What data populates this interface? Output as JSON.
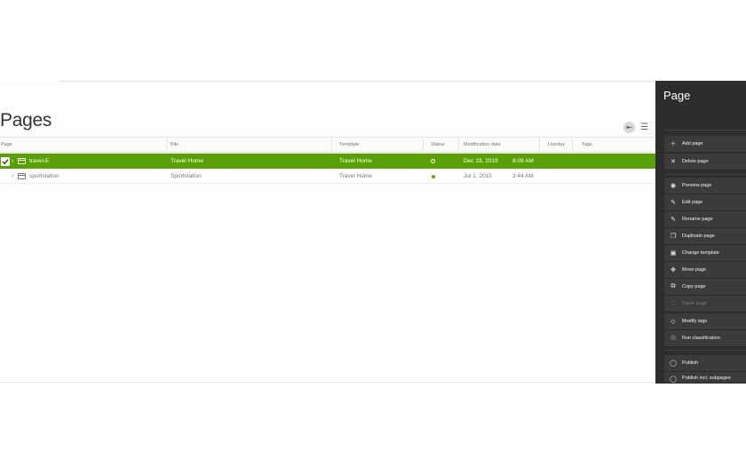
{
  "page": {
    "title": "Pages"
  },
  "table": {
    "columns": [
      "Page",
      "Title",
      "Template",
      "Status",
      "Modification date",
      "Liveday",
      "Tags"
    ],
    "rows": [
      {
        "name": "travel-E",
        "title": "Travel Home",
        "template": "Travel Home",
        "date": "Dec 19, 2019",
        "time": "8:09 AM",
        "selected": true
      },
      {
        "name": "sportstation",
        "title": "Sportstation",
        "template": "Travel Home",
        "date": "Jul 1, 2015",
        "time": "3:44 AM",
        "selected": false
      }
    ]
  },
  "panel": {
    "title": "Page",
    "groups": [
      [
        {
          "label": "Add page",
          "icon": "plus-icon"
        },
        {
          "label": "Delete page",
          "icon": "close-icon"
        }
      ],
      [
        {
          "label": "Preview page",
          "icon": "eye-icon"
        },
        {
          "label": "Edit page",
          "icon": "pencil-icon"
        },
        {
          "label": "Rename page",
          "icon": "pencil-icon"
        },
        {
          "label": "Duplicate page",
          "icon": "duplicate-icon"
        },
        {
          "label": "Change template",
          "icon": "template-icon"
        },
        {
          "label": "Move page",
          "icon": "move-icon"
        },
        {
          "label": "Copy page",
          "icon": "copy-icon"
        },
        {
          "label": "Paste page",
          "icon": "paste-icon",
          "disabled": true
        },
        {
          "label": "Modify tags",
          "icon": "tag-icon"
        },
        {
          "label": "Run classification",
          "icon": "classification-icon"
        }
      ],
      [
        {
          "label": "Publish",
          "icon": "publish-icon"
        },
        {
          "label": "Publish incl. subpages",
          "icon": "publish-icon"
        }
      ]
    ]
  },
  "colors": {
    "selected_row": "#57a102",
    "panel_bg": "#2d2d2d",
    "status_green": "#5aa51a"
  }
}
